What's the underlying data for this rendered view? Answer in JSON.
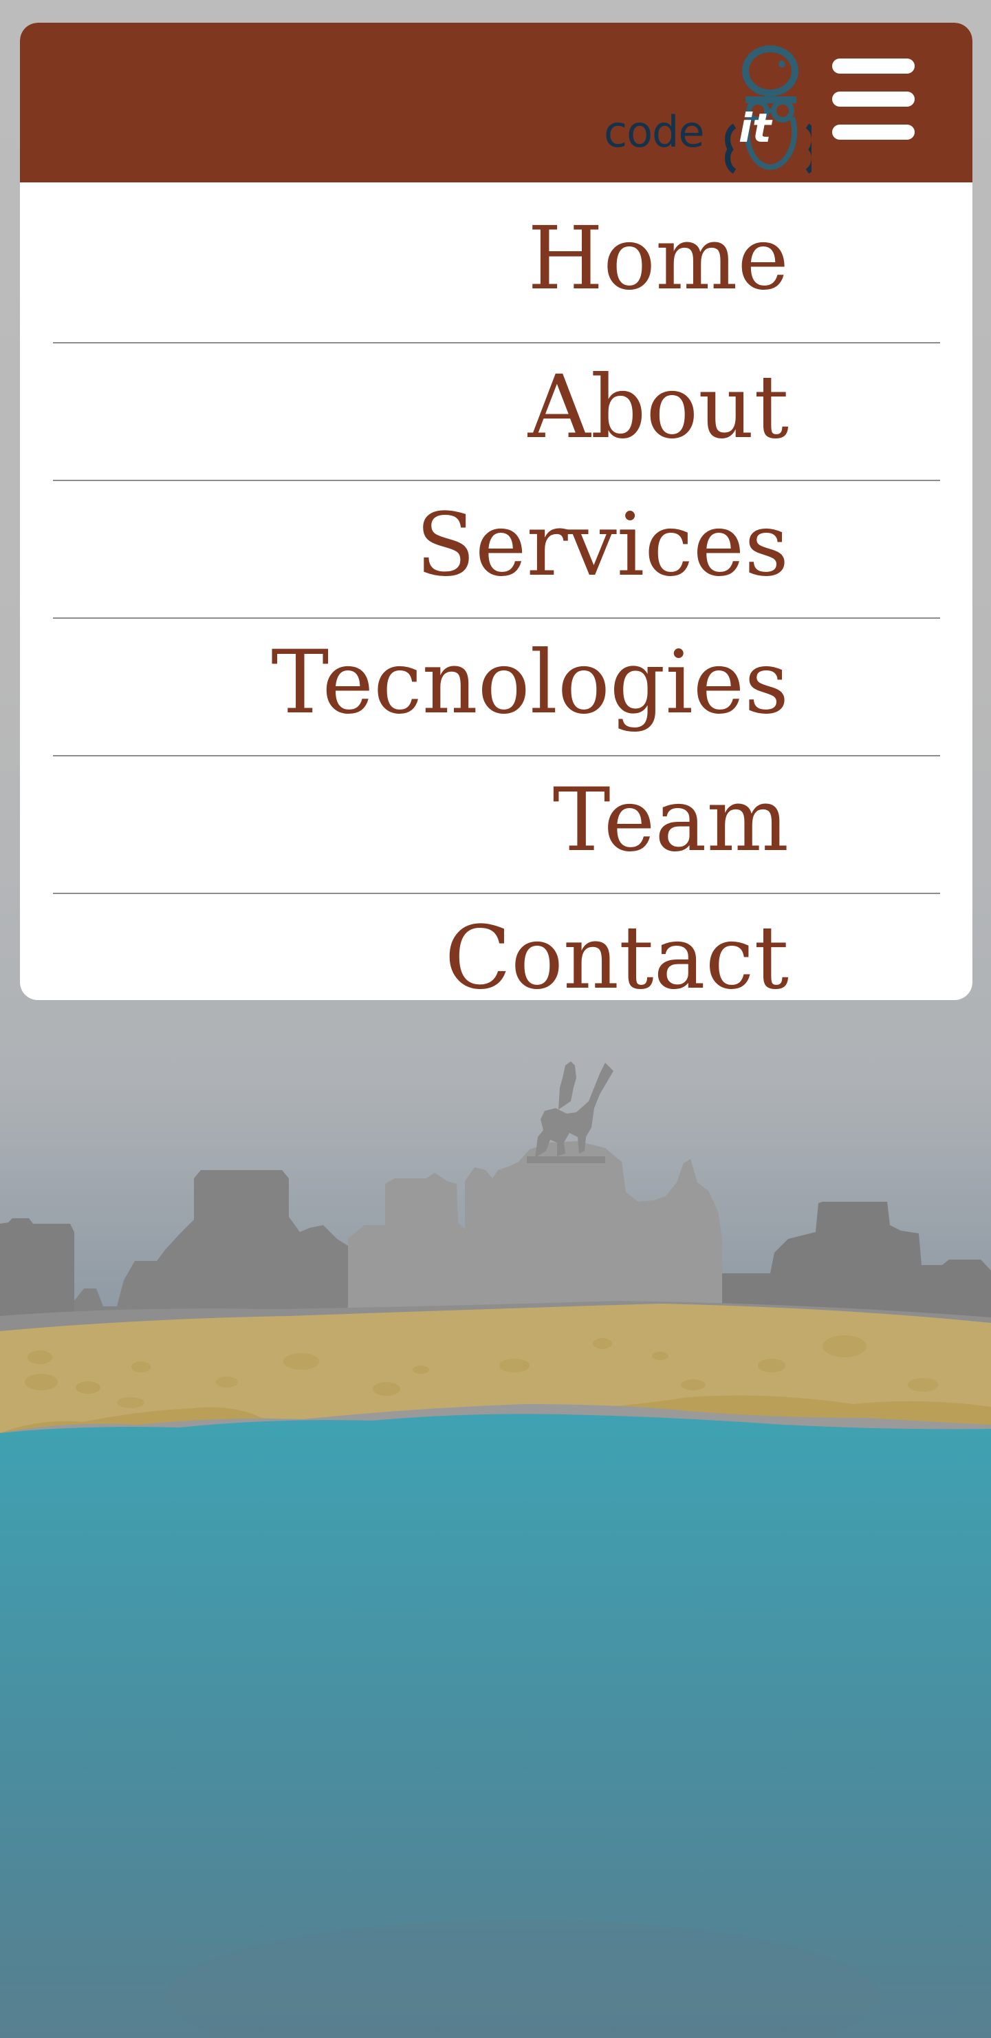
{
  "brand": {
    "logo_word": "code",
    "logo_accent": "it",
    "colors": {
      "header": "#7f3720",
      "nav_text": "#7f3720",
      "logo_text": "#14324a",
      "logo_mascot": "#2f5f72",
      "panel": "#ffffff",
      "page_background": "#bcbcbc"
    }
  },
  "header": {
    "menu_icon": "hamburger-menu-icon"
  },
  "nav": {
    "items": [
      {
        "label": "Home"
      },
      {
        "label": "About"
      },
      {
        "label": "Services"
      },
      {
        "label": "Tecnologies"
      },
      {
        "label": "Team"
      },
      {
        "label": "Contact"
      }
    ]
  },
  "scene": {
    "icons": [
      "city-skyline-illustration",
      "equestrian-statue-icon",
      "beach-sand-illustration",
      "sea-water-illustration"
    ]
  }
}
